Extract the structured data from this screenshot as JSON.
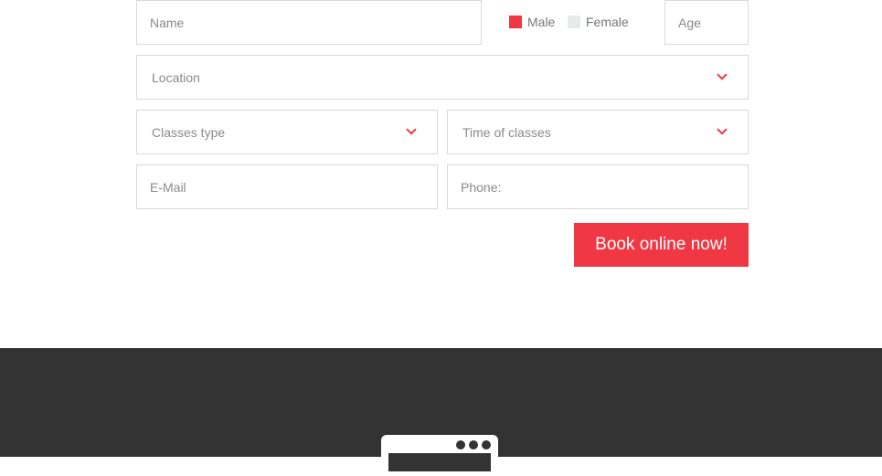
{
  "form": {
    "name_placeholder": "Name",
    "gender": {
      "male_label": "Male",
      "female_label": "Female",
      "selected": "Male"
    },
    "age_placeholder": "Age",
    "location_label": "Location",
    "classes_type_label": "Classes type",
    "time_of_classes_label": "Time of classes",
    "email_placeholder": "E-Mail",
    "phone_placeholder": "Phone:",
    "submit_label": "Book online now!"
  },
  "colors": {
    "accent": "#ef3844",
    "unchecked_box": "#e6ebea",
    "footer_bg": "#333333",
    "border": "#d9d9d9"
  },
  "icons": {
    "dropdown": "chevron-down-icon",
    "footer": "browser-window-icon"
  }
}
